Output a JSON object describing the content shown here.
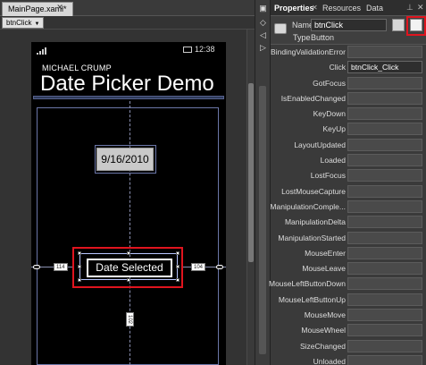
{
  "document_tab": {
    "title": "MainPage.xaml*"
  },
  "element_dropdown": {
    "value": "btnClick"
  },
  "phone": {
    "clock": "12:38",
    "app_title": "MICHAEL CRUMP",
    "page_title": "Date Picker Demo",
    "date_value": "9/16/2010",
    "button_label": "Date Selected",
    "margin_left": "114",
    "margin_right": "104",
    "margin_bottom": "102"
  },
  "properties": {
    "tabs": [
      "Properties",
      "Resources",
      "Data"
    ],
    "name_label": "Name",
    "name_value": "btnClick",
    "type_label": "Type",
    "type_value": "Button",
    "events": [
      {
        "label": "BindingValidationError",
        "value": ""
      },
      {
        "label": "Click",
        "value": "btnClick_Click"
      },
      {
        "label": "GotFocus",
        "value": ""
      },
      {
        "label": "IsEnabledChanged",
        "value": ""
      },
      {
        "label": "KeyDown",
        "value": ""
      },
      {
        "label": "KeyUp",
        "value": ""
      },
      {
        "label": "LayoutUpdated",
        "value": ""
      },
      {
        "label": "Loaded",
        "value": ""
      },
      {
        "label": "LostFocus",
        "value": ""
      },
      {
        "label": "LostMouseCapture",
        "value": ""
      },
      {
        "label": "ManipulationComple...",
        "value": ""
      },
      {
        "label": "ManipulationDelta",
        "value": ""
      },
      {
        "label": "ManipulationStarted",
        "value": ""
      },
      {
        "label": "MouseEnter",
        "value": ""
      },
      {
        "label": "MouseLeave",
        "value": ""
      },
      {
        "label": "MouseLeftButtonDown",
        "value": ""
      },
      {
        "label": "MouseLeftButtonUp",
        "value": ""
      },
      {
        "label": "MouseMove",
        "value": ""
      },
      {
        "label": "MouseWheel",
        "value": ""
      },
      {
        "label": "SizeChanged",
        "value": ""
      },
      {
        "label": "Unloaded",
        "value": ""
      }
    ]
  },
  "colors": {
    "highlight": "#e0141e",
    "selection": "#b8c6ff",
    "panel": "#3a3a3a"
  }
}
